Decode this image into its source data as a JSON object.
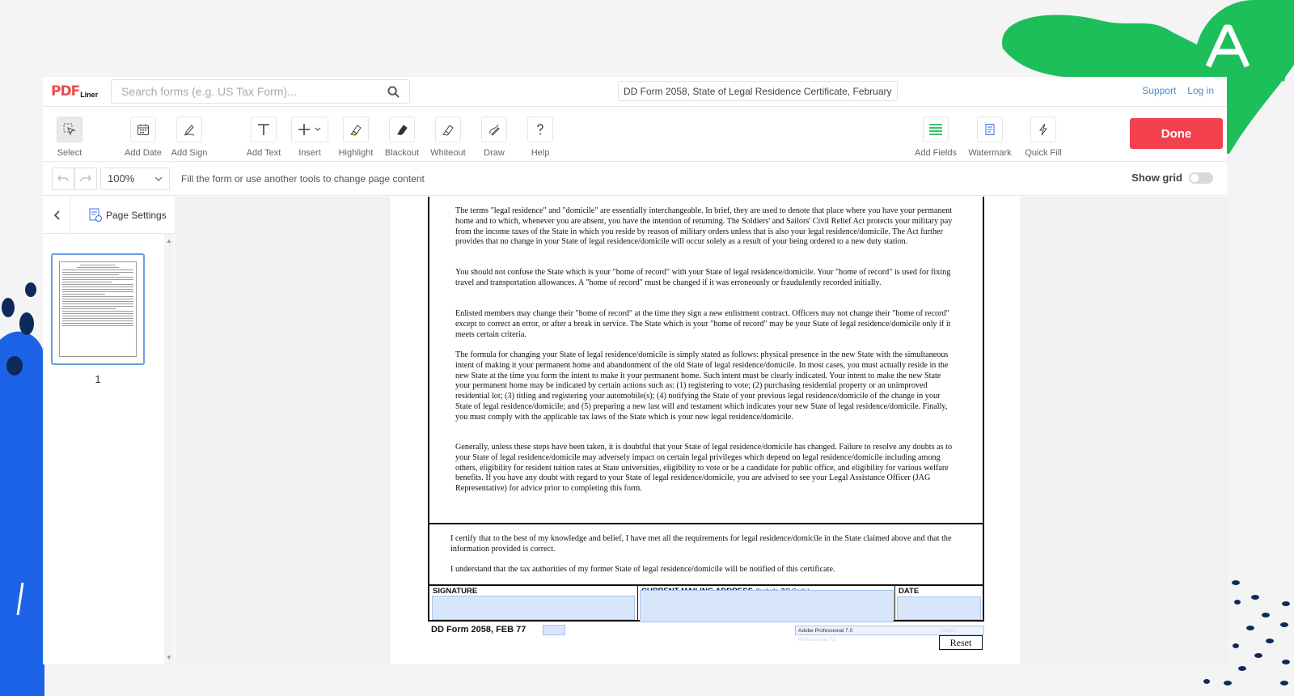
{
  "app": {
    "logo_main": "PDF",
    "logo_sub": "Liner",
    "search_placeholder": "Search forms (e.g. US Tax Form)...",
    "doc_title": "DD Form 2058, State of Legal Residence Certificate, February",
    "links": {
      "support": "Support",
      "login": "Log in"
    }
  },
  "toolbar": {
    "tools": [
      {
        "label": "Select",
        "icon": "cursor-icon"
      },
      {
        "label": "Add Date",
        "icon": "calendar-icon"
      },
      {
        "label": "Add Sign",
        "icon": "pen-sign-icon"
      },
      {
        "label": "Add Text",
        "icon": "text-icon"
      },
      {
        "label": "Insert",
        "icon": "plus-icon"
      },
      {
        "label": "Highlight",
        "icon": "highlighter-icon"
      },
      {
        "label": "Blackout",
        "icon": "blackout-icon"
      },
      {
        "label": "Whiteout",
        "icon": "eraser-icon"
      },
      {
        "label": "Draw",
        "icon": "draw-icon"
      },
      {
        "label": "Help",
        "icon": "question-icon"
      },
      {
        "label": "Add Fields",
        "icon": "fields-icon"
      },
      {
        "label": "Watermark",
        "icon": "watermark-icon"
      },
      {
        "label": "Quick Fill",
        "icon": "lightning-icon"
      }
    ],
    "done_label": "Done"
  },
  "subbar": {
    "zoom": "100%",
    "hint": "Fill the form or use another tools to change page content",
    "show_grid": "Show grid"
  },
  "sidebar": {
    "page_settings": "Page Settings",
    "page_number": "1"
  },
  "document": {
    "paragraphs": [
      "The terms \"legal residence\" and \"domicile\" are essentially interchangeable.  In brief, they are used to denote that place where you have your permanent home and to which, whenever you are absent, you have the intention of returning.  The Soldiers' and Sailors' Civil Relief Act protects your military pay from the income taxes of the State in which you reside by reason of military orders unless that is also your legal residence/domicile.  The Act further provides that no change in your State of legal residence/domicile will occur solely as a result of your being ordered to a new duty station.",
      "You should not confuse the State which is your \"home of record\" with your State of legal residence/domicile.  Your \"home of record\" is used for fixing travel and transportation allowances.  A \"home of record\" must be changed if it was erroneously or fraudulently recorded initially.",
      "Enlisted members may change their \"home of record\" at the time they sign a new enlistment contract.  Officers may not change their \"home of record\" except to correct an error, or after a break in service.  The State which is your \"home of record\" may be your State of legal residence/domicile only if it meets certain criteria.",
      "The formula for changing your State of legal residence/domicile is simply stated as follows: physical presence in the new State with the simultaneous intent of making it your permanent home and abandonment of the old State of legal residence/domicile. In most cases, you must actually reside in the new State at the time you form the intent to make it your permanent home.  Such intent must be clearly indicated.  Your intent to make the new State your permanent home may be indicated by certain actions such as: (1) registering to vote; (2) purchasing residential property or an unimproved residential lot; (3) titling and registering your automobile(s); (4) notifying the State of your previous legal residence/domicile of the change in your State of legal residence/domicile; and (5) preparing a new last will and testament which indicates your new State of legal residence/domicile. Finally, you must comply with the applicable tax laws of the State which is your new legal residence/domicile.",
      "Generally, unless these steps have been taken, it is doubtful that your State of legal residence/domicile has changed.  Failure to resolve any doubts as to your State of legal residence/domicile may adversely impact on certain legal privileges which depend on legal residence/domicile including among others, eligibility for resident tuition rates at State universities, eligibility to vote or be a candidate for public office, and eligibility for various welfare benefits.  If you have any doubt with regard to your State of legal residence/domicile, you are advised to see your Legal Assistance Officer (JAG Representative) for advice prior to completing this form."
    ],
    "certify_1": "I certify that to the best of my knowledge and belief, I have met all the requirements for legal residence/domicile in the State claimed above and that the information provided is correct.",
    "certify_2": "I understand that the tax authorities of my former State of legal residence/domicile will be notified of this certificate.",
    "sig_label": "SIGNATURE",
    "address_label": "CURRENT MAILING ADDRESS",
    "address_hint": "(Include ZIP Code)",
    "date_label": "DATE",
    "form_id": "DD Form 2058, FEB 77",
    "adobe_text": "Adobe Professional 7.0",
    "adobe_ghost": "Adobe Professional 7.0",
    "reset_label": "Reset"
  },
  "colors": {
    "accent_green": "#1dbf5b",
    "accent_blue": "#1d63e8",
    "done_red": "#f2404e",
    "field_blue": "#d8e6fb"
  }
}
